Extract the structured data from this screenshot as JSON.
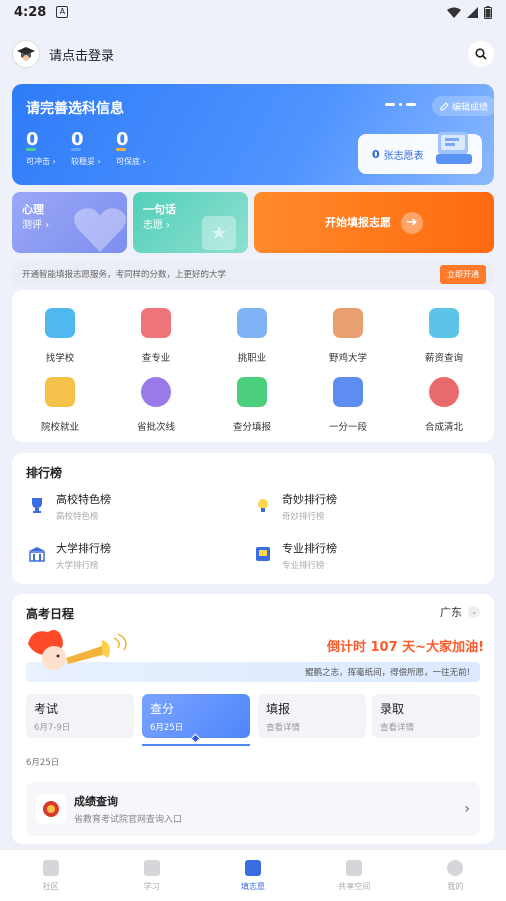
{
  "status_bar": {
    "time": "4:28",
    "sim_icon": "A"
  },
  "header": {
    "login_text": "请点击登录"
  },
  "hero": {
    "title": "请完善选科信息",
    "edit_label": "编辑成绩",
    "stats": [
      {
        "value": "0",
        "label": "可冲击 ›",
        "color": "#4ad18a"
      },
      {
        "value": "0",
        "label": "较稳妥 ›",
        "color": "#6aa3ff"
      },
      {
        "value": "0",
        "label": "可保底 ›",
        "color": "#ffb23a"
      }
    ],
    "wish_count": "0",
    "wish_label": "张志愿表"
  },
  "quick": {
    "psych_title": "心理",
    "psych_sub": "测评 ›",
    "slogan_title": "一句话",
    "slogan_sub": "志愿 ›",
    "start_label": "开始填报志愿"
  },
  "promo": {
    "text": "开通智能填报志愿服务，考同样的分数，上更好的大学",
    "button": "立即开通"
  },
  "grid": [
    {
      "label": "找学校",
      "icon": "school-icon",
      "color": "#4fb8f0"
    },
    {
      "label": "查专业",
      "icon": "major-icon",
      "color": "#f0757a"
    },
    {
      "label": "挑职业",
      "icon": "career-icon",
      "color": "#7fb2f5"
    },
    {
      "label": "野鸡大学",
      "icon": "fake-university-icon",
      "color": "#e8a070"
    },
    {
      "label": "薪资查询",
      "icon": "salary-icon",
      "color": "#5cc4e8"
    },
    {
      "label": "院校就业",
      "icon": "employment-icon",
      "color": "#f4c24a"
    },
    {
      "label": "省批次线",
      "icon": "batch-line-icon",
      "color": "#9a7ae8"
    },
    {
      "label": "查分填报",
      "icon": "score-fill-icon",
      "color": "#4ccf7c"
    },
    {
      "label": "一分一段",
      "icon": "score-segment-icon",
      "color": "#5e8df2"
    },
    {
      "label": "合成清北",
      "icon": "tsinghua-peking-icon",
      "color": "#e86a6a"
    }
  ],
  "ranking": {
    "title": "排行榜",
    "items": [
      {
        "title": "高校特色榜",
        "sub": "高校特色榜",
        "icon": "trophy-icon"
      },
      {
        "title": "奇妙排行榜",
        "sub": "奇妙排行榜",
        "icon": "lightbulb-icon"
      },
      {
        "title": "大学排行榜",
        "sub": "大学排行榜",
        "icon": "university-icon"
      },
      {
        "title": "专业排行榜",
        "sub": "专业排行榜",
        "icon": "book-icon"
      }
    ]
  },
  "schedule": {
    "title": "高考日程",
    "region": "广东",
    "countdown": "倒计时 107 天~大家加油!",
    "motto": "鲲鹏之志，挥毫纸间，得偿所愿，一往无前!",
    "tabs": [
      {
        "title": "考试",
        "sub": "6月7-9日"
      },
      {
        "title": "查分",
        "sub": "6月25日"
      },
      {
        "title": "填报",
        "sub": "查看详情"
      },
      {
        "title": "录取",
        "sub": "查看详情"
      }
    ],
    "date_label": "6月25日",
    "score_query_title": "成绩查询",
    "score_query_sub": "省教育考试院官网查询入口"
  },
  "tabbar": [
    {
      "label": "社区"
    },
    {
      "label": "学习"
    },
    {
      "label": "填志愿"
    },
    {
      "label": "共享空间"
    },
    {
      "label": "我的"
    }
  ]
}
